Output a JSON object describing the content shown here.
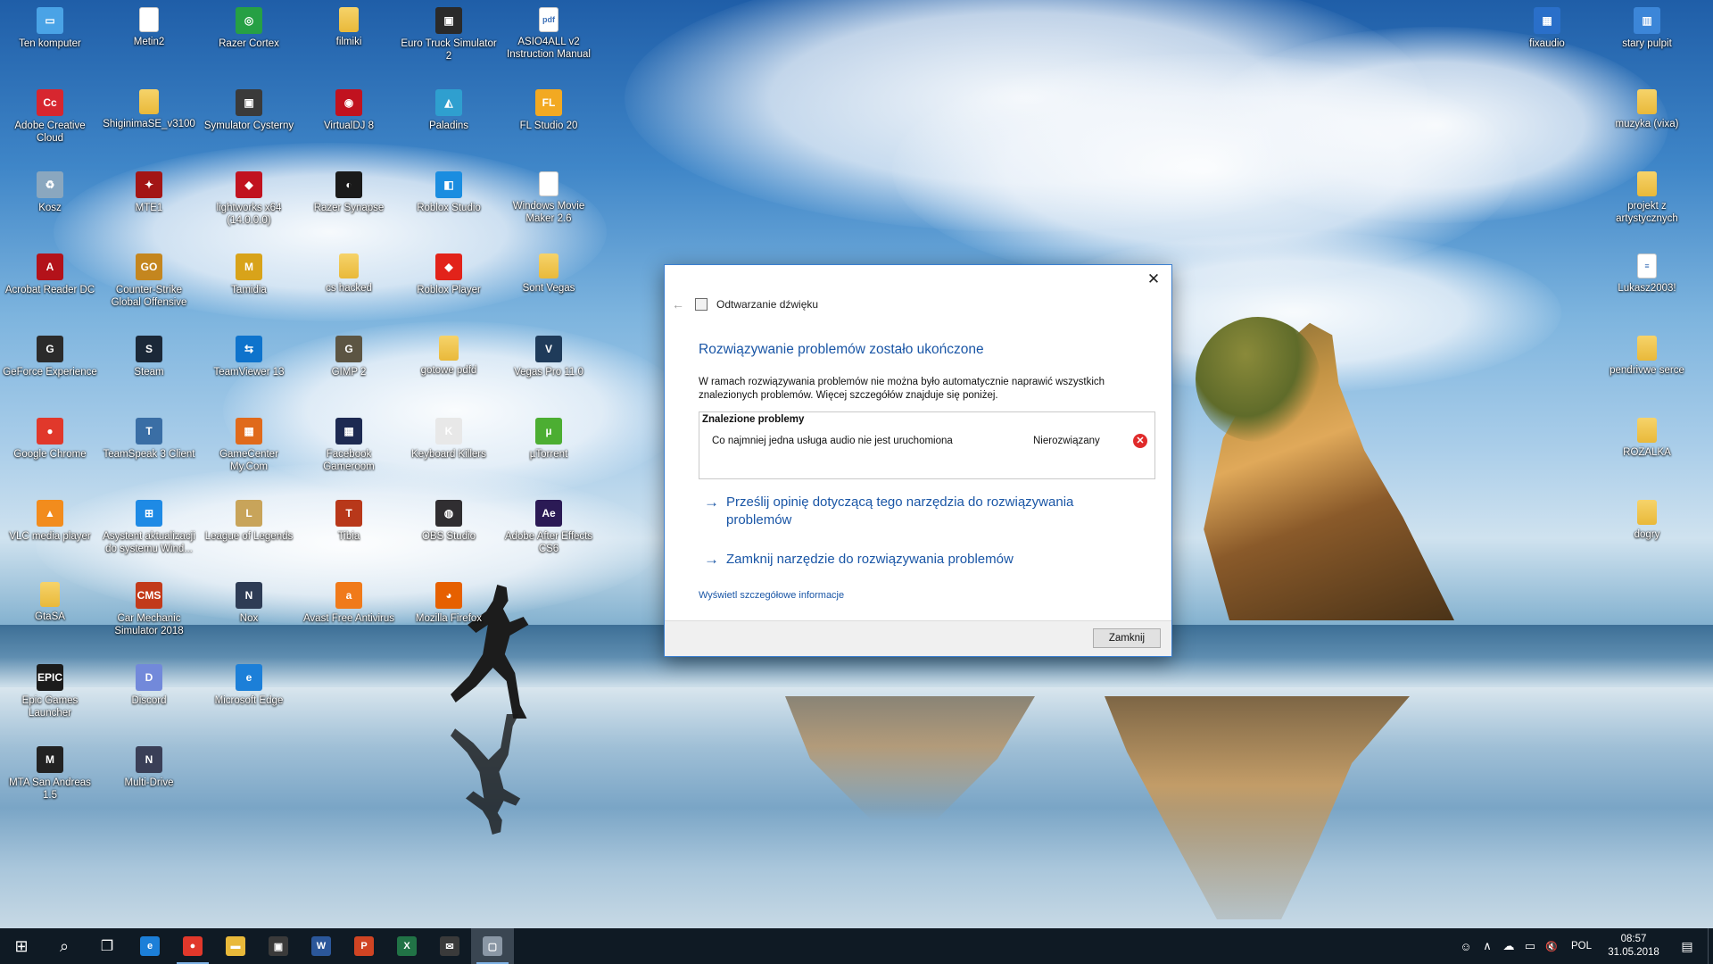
{
  "desktop_icons": [
    {
      "label": "Ten komputer",
      "icon": "computer-icon",
      "glyph": "▭",
      "bg": "#4aa3e6"
    },
    {
      "label": "Adobe Creative Cloud",
      "icon": "creative-cloud-icon",
      "glyph": "Cc",
      "bg": "#d7262f"
    },
    {
      "label": "Kosz",
      "icon": "recycle-bin-icon",
      "glyph": "♻",
      "bg": "#8aa7bf"
    },
    {
      "label": "Acrobat Reader DC",
      "icon": "acrobat-icon",
      "glyph": "A",
      "bg": "#b3121a"
    },
    {
      "label": "GeForce Experience",
      "icon": "geforce-icon",
      "glyph": "G",
      "bg": "#2b2b2b"
    },
    {
      "label": "Google Chrome",
      "icon": "chrome-icon",
      "glyph": "●",
      "bg": "#e1382b"
    },
    {
      "label": "VLC media player",
      "icon": "vlc-icon",
      "glyph": "▲",
      "bg": "#f28c1d"
    },
    {
      "label": "GtaSA",
      "icon": "folder-icon",
      "glyph": "",
      "bg": "folder"
    },
    {
      "label": "Epic Games Launcher",
      "icon": "epic-games-icon",
      "glyph": "EPIC",
      "bg": "#1b1b1b"
    },
    {
      "label": "MTA San Andreas 1.5",
      "icon": "mta-icon",
      "glyph": "M",
      "bg": "#222222"
    },
    {
      "label": "Metin2",
      "icon": "file-icon",
      "glyph": "",
      "bg": "file"
    },
    {
      "label": "ShiginimaSE_v3100",
      "icon": "folder-icon",
      "glyph": "",
      "bg": "folder"
    },
    {
      "label": "MTE1",
      "icon": "mte-icon",
      "glyph": "✦",
      "bg": "#a31515"
    },
    {
      "label": "Counter-Strike Global Offensive",
      "icon": "csgo-icon",
      "glyph": "GO",
      "bg": "#c4861f"
    },
    {
      "label": "Steam",
      "icon": "steam-icon",
      "glyph": "S",
      "bg": "#1b2838"
    },
    {
      "label": "TeamSpeak 3 Client",
      "icon": "teamspeak-icon",
      "glyph": "T",
      "bg": "#3a6ea5"
    },
    {
      "label": "Asystent aktualizacji do systemu Wind...",
      "icon": "windows-icon",
      "glyph": "⊞",
      "bg": "#1e8ae5"
    },
    {
      "label": "Car Mechanic Simulator 2018",
      "icon": "cms-icon",
      "glyph": "CMS",
      "bg": "#c23a1a"
    },
    {
      "label": "Discord",
      "icon": "discord-icon",
      "glyph": "D",
      "bg": "#7289da"
    },
    {
      "label": "Multi-Drive",
      "icon": "nox-icon",
      "glyph": "N",
      "bg": "#3a3f57"
    },
    {
      "label": "Razer Cortex",
      "icon": "razer-cortex-icon",
      "glyph": "◎",
      "bg": "#26a044"
    },
    {
      "label": "Symulator Cysterny",
      "icon": "truck-icon",
      "glyph": "▣",
      "bg": "#3a3a3a"
    },
    {
      "label": "lightworks x64 (14.0.0.0)",
      "icon": "lightworks-icon",
      "glyph": "◆",
      "bg": "#c1121f"
    },
    {
      "label": "Tamidia",
      "icon": "tamidia-icon",
      "glyph": "M",
      "bg": "#d8a31a"
    },
    {
      "label": "TeamViewer 13",
      "icon": "teamviewer-icon",
      "glyph": "⇆",
      "bg": "#0e73cc"
    },
    {
      "label": "GameCenter My.Com",
      "icon": "gamecenter-icon",
      "glyph": "▦",
      "bg": "#e06a1b"
    },
    {
      "label": "League of Legends",
      "icon": "lol-icon",
      "glyph": "L",
      "bg": "#c8a45a"
    },
    {
      "label": "Nox",
      "icon": "nox-icon",
      "glyph": "N",
      "bg": "#2e3c55"
    },
    {
      "label": "Microsoft Edge",
      "icon": "edge-icon",
      "glyph": "e",
      "bg": "#1c7fd8"
    },
    {
      "label": "filmiki",
      "icon": "folder-icon",
      "glyph": "",
      "bg": "folder"
    },
    {
      "label": "VirtualDJ 8",
      "icon": "virtualdj-icon",
      "glyph": "◉",
      "bg": "#c1121f"
    },
    {
      "label": "Razer Synapse",
      "icon": "razer-synapse-icon",
      "glyph": "◐",
      "bg": "#1a1a1a"
    },
    {
      "label": "cs hacked",
      "icon": "folder-icon",
      "glyph": "",
      "bg": "folder"
    },
    {
      "label": "GIMP 2",
      "icon": "gimp-icon",
      "glyph": "G",
      "bg": "#5c5543"
    },
    {
      "label": "Facebook Gameroom",
      "icon": "gameroom-icon",
      "glyph": "▦",
      "bg": "#1d2a52"
    },
    {
      "label": "Tibia",
      "icon": "tibia-icon",
      "glyph": "T",
      "bg": "#b8381a"
    },
    {
      "label": "Avast Free Antivirus",
      "icon": "avast-icon",
      "glyph": "a",
      "bg": "#f07a1a"
    },
    {
      "label": "Euro Truck Simulator 2",
      "icon": "ets2-icon",
      "glyph": "▣",
      "bg": "#2a2a2a"
    },
    {
      "label": "Paladins",
      "icon": "paladins-icon",
      "glyph": "◭",
      "bg": "#2f9fcf"
    },
    {
      "label": "Roblox Studio",
      "icon": "roblox-studio-icon",
      "glyph": "◧",
      "bg": "#1a8de0"
    },
    {
      "label": "Roblox Player",
      "icon": "roblox-icon",
      "glyph": "◆",
      "bg": "#e2231a"
    },
    {
      "label": "gotowe pdfd",
      "icon": "folder-icon",
      "glyph": "",
      "bg": "folder"
    },
    {
      "label": "Keyboard Killers",
      "icon": "keyboard-killers-icon",
      "glyph": "K",
      "bg": "#e8e8e8"
    },
    {
      "label": "OBS Studio",
      "icon": "obs-icon",
      "glyph": "◍",
      "bg": "#302e31"
    },
    {
      "label": "Mozilla Firefox",
      "icon": "firefox-icon",
      "glyph": "◕",
      "bg": "#e66000"
    },
    {
      "label": "ASIO4ALL v2 Instruction Manual",
      "icon": "pdf-file-icon",
      "glyph": "pdf",
      "bg": "file"
    },
    {
      "label": "FL Studio 20",
      "icon": "fl-studio-icon",
      "glyph": "FL",
      "bg": "#f2a922"
    },
    {
      "label": "Windows Movie Maker 2.6",
      "icon": "file-icon",
      "glyph": "",
      "bg": "file"
    },
    {
      "label": "Sont Vegas",
      "icon": "folder-icon",
      "glyph": "",
      "bg": "folder"
    },
    {
      "label": "Vegas Pro 11.0",
      "icon": "vegas-icon",
      "glyph": "V",
      "bg": "#1f3b5a"
    },
    {
      "label": "µTorrent",
      "icon": "utorrent-icon",
      "glyph": "µ",
      "bg": "#4cae32"
    },
    {
      "label": "Adobe After Effects CS6",
      "icon": "after-effects-icon",
      "glyph": "Ae",
      "bg": "#2b1a55"
    },
    {
      "label": "fixaudio",
      "icon": "fixaudio-icon",
      "glyph": "▦",
      "bg": "#2a6fc9"
    },
    {
      "label": "stary pulpit",
      "icon": "shortcut-icon",
      "glyph": "▥",
      "bg": "#3c86d8"
    },
    {
      "label": "muzyka (vixa)",
      "icon": "folder-icon",
      "glyph": "",
      "bg": "folder"
    },
    {
      "label": "projekt z artystycznych",
      "icon": "folder-icon",
      "glyph": "",
      "bg": "folder"
    },
    {
      "label": "Lukasz2003!",
      "icon": "text-file-icon",
      "glyph": "≡",
      "bg": "file"
    },
    {
      "label": "pendrivwe serce",
      "icon": "folder-icon",
      "glyph": "",
      "bg": "folder"
    },
    {
      "label": "ROZALKA",
      "icon": "folder-icon",
      "glyph": "",
      "bg": "folder"
    },
    {
      "label": "dogry",
      "icon": "folder-icon",
      "glyph": "",
      "bg": "folder"
    }
  ],
  "dialog": {
    "app_name": "Odtwarzanie dźwięku",
    "close_glyph": "✕",
    "back_glyph": "←",
    "title": "Rozwiązywanie problemów zostało ukończone",
    "description": "W ramach rozwiązywania problemów nie można było automatycznie naprawić wszystkich znalezionych problemów. Więcej szczegółów znajduje się poniżej.",
    "found_header": "Znalezione problemy",
    "problem": {
      "name": "Co najmniej jedna usługa audio nie jest uruchomiona",
      "status": "Nierozwiązany",
      "status_glyph": "✕"
    },
    "link_feedback": "Prześlij opinię dotyczącą tego narzędzia do rozwiązywania problemów",
    "link_close_tool": "Zamknij narzędzie do rozwiązywania problemów",
    "link_details": "Wyświetl szczegółowe informacje",
    "close_button": "Zamknij",
    "accent": "#1a56a6"
  },
  "taskbar": {
    "start_glyph": "⊞",
    "search_glyph": "⌕",
    "taskview_glyph": "❐",
    "apps": [
      {
        "name": "edge",
        "glyph": "e",
        "bg": "#1c7fd8"
      },
      {
        "name": "chrome",
        "glyph": "●",
        "bg": "#e1382b"
      },
      {
        "name": "file-explorer",
        "glyph": "▬",
        "bg": "#e9b93a"
      },
      {
        "name": "store",
        "glyph": "▣",
        "bg": "#3a3a3a"
      },
      {
        "name": "word",
        "glyph": "W",
        "bg": "#2b579a"
      },
      {
        "name": "powerpoint",
        "glyph": "P",
        "bg": "#d04423"
      },
      {
        "name": "excel",
        "glyph": "X",
        "bg": "#217346"
      },
      {
        "name": "mail",
        "glyph": "✉",
        "bg": "#3a3a3a"
      },
      {
        "name": "troubleshooter",
        "glyph": "▢",
        "bg": "#8a97a5"
      }
    ],
    "tray": {
      "people_glyph": "☺",
      "chevron_glyph": "∧",
      "cloud_glyph": "☁",
      "network_glyph": "▭",
      "volume_glyph": "🔇",
      "language": "POL",
      "time": "08:57",
      "date": "31.05.2018",
      "notifications_glyph": "▤"
    }
  }
}
